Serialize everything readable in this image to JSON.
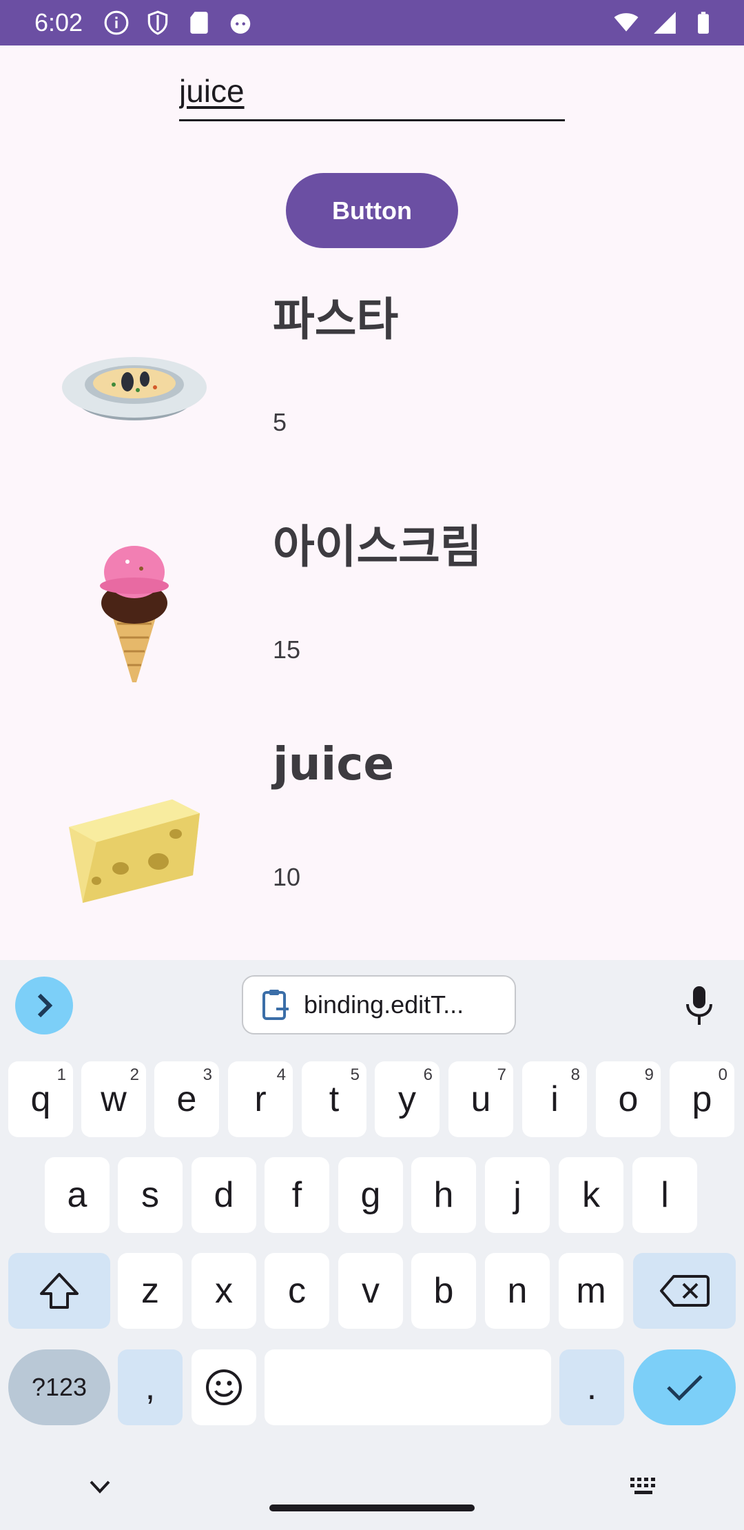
{
  "status_bar": {
    "time": "6:02",
    "left_icons": [
      "info-icon",
      "shield-icon",
      "sd-card-icon",
      "cat-icon"
    ],
    "right_icons": [
      "wifi-icon",
      "signal-icon",
      "battery-icon"
    ]
  },
  "search": {
    "value": "juice"
  },
  "button": {
    "label": "Button"
  },
  "items": [
    {
      "name": "파스타",
      "count": "5",
      "icon": "pasta-bowl-image"
    },
    {
      "name": "아이스크림",
      "count": "15",
      "icon": "ice-cream-image"
    },
    {
      "name": "juice",
      "count": "10",
      "icon": "cheese-image"
    }
  ],
  "keyboard": {
    "clipboard_text": "binding.editT...",
    "row1": [
      {
        "key": "q",
        "hint": "1"
      },
      {
        "key": "w",
        "hint": "2"
      },
      {
        "key": "e",
        "hint": "3"
      },
      {
        "key": "r",
        "hint": "4"
      },
      {
        "key": "t",
        "hint": "5"
      },
      {
        "key": "y",
        "hint": "6"
      },
      {
        "key": "u",
        "hint": "7"
      },
      {
        "key": "i",
        "hint": "8"
      },
      {
        "key": "o",
        "hint": "9"
      },
      {
        "key": "p",
        "hint": "0"
      }
    ],
    "row2": [
      "a",
      "s",
      "d",
      "f",
      "g",
      "h",
      "j",
      "k",
      "l"
    ],
    "row3": [
      "z",
      "x",
      "c",
      "v",
      "b",
      "n",
      "m"
    ],
    "symbols_label": "?123",
    "comma_label": ",",
    "period_label": ".",
    "accent_color": "#7ccff8",
    "special_key_color": "#d3e4f5"
  },
  "colors": {
    "brand": "#6b4fa3",
    "background": "#fdf6fb"
  }
}
